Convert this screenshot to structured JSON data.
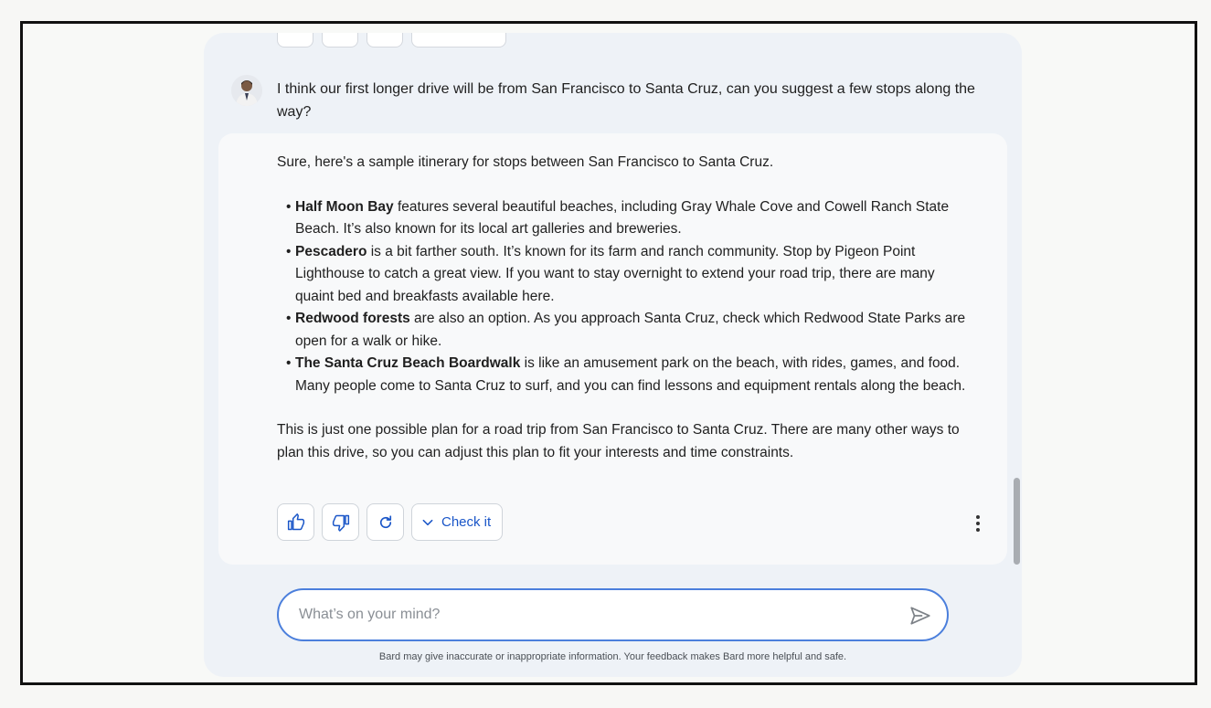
{
  "conversation": {
    "user_message": "I think our first longer drive will be from San Francisco to Santa Cruz, can you suggest a few stops along the way?",
    "response": {
      "intro": "Sure, here's a sample itinerary for stops between San Francisco to Santa Cruz.",
      "items": [
        {
          "title": "Half Moon Bay",
          "text": " features several beautiful beaches, including Gray Whale Cove and Cowell Ranch State Beach. It’s also known for its local art galleries and breweries."
        },
        {
          "title": "Pescadero",
          "text": " is a bit farther south. It’s known for its farm and ranch community. Stop by Pigeon Point Lighthouse to catch a great view. If you want to stay overnight to extend your road trip, there are many quaint bed and breakfasts available here."
        },
        {
          "title": "Redwood forests",
          "text": " are also an option. As you approach Santa Cruz, check which Redwood State Parks are open for a walk or hike."
        },
        {
          "title": "The Santa Cruz Beach Boardwalk",
          "text": " is like an amusement park on the beach, with rides, games, and food. Many people come to Santa Cruz to surf, and you can find lessons and equipment rentals along the beach."
        }
      ],
      "outro": "This is just one possible plan for a road trip from San Francisco to Santa Cruz. There are many other ways to plan this drive, so you can adjust this plan to fit your interests and time constraints."
    },
    "actions": {
      "thumbs_up_icon": "thumbs-up-icon",
      "thumbs_down_icon": "thumbs-down-icon",
      "regenerate_icon": "refresh-icon",
      "check_label": "Check it",
      "more_icon": "more-vert-icon"
    }
  },
  "input": {
    "placeholder": "What’s on your mind?",
    "value": ""
  },
  "disclaimer": "Bard may give inaccurate or inappropriate information. Your feedback makes Bard more helpful and safe.",
  "colors": {
    "accent": "#1a56c8",
    "input_border": "#4b7fdc",
    "panel_bg": "#eef2f7",
    "response_bg": "#f8f9fa"
  }
}
